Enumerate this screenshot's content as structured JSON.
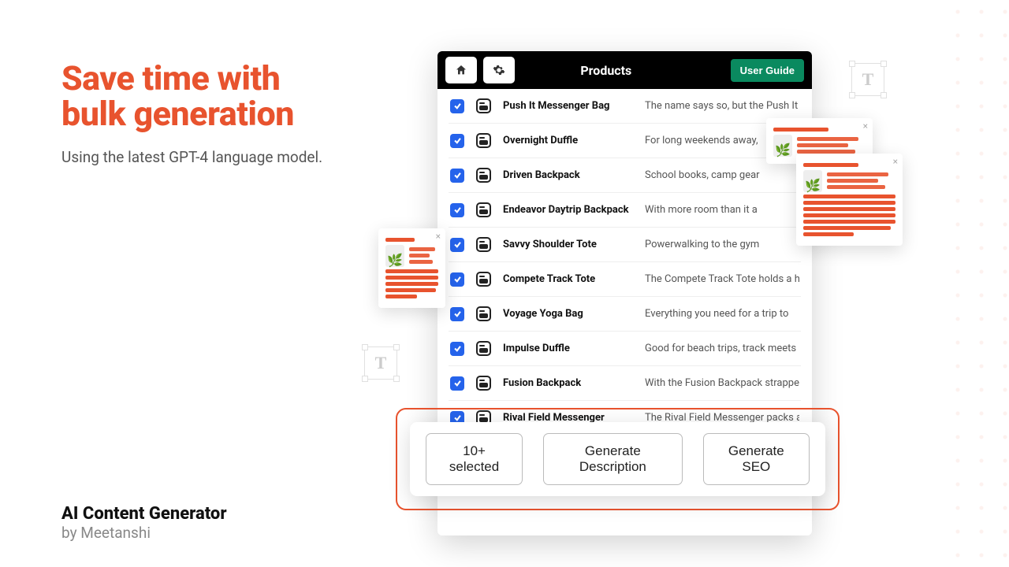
{
  "headline": {
    "title_line1": "Save time with",
    "title_line2": "bulk generation",
    "subtitle": "Using the latest GPT-4 language model."
  },
  "brand": {
    "title": "AI Content Generator",
    "sub": "by Meetanshi"
  },
  "app": {
    "title": "Products",
    "user_guide": "User Guide"
  },
  "products": [
    {
      "name": "Push It Messenger Bag",
      "desc": "The name says so, but the Push It"
    },
    {
      "name": "Overnight Duffle",
      "desc": "For long weekends away,"
    },
    {
      "name": "Driven Backpack",
      "desc": "School books, camp gear"
    },
    {
      "name": "Endeavor Daytrip Backpack",
      "desc": "With more room than it a"
    },
    {
      "name": "Savvy Shoulder Tote",
      "desc": "Powerwalking to the gym"
    },
    {
      "name": "Compete Track Tote",
      "desc": "The Compete Track Tote holds a h"
    },
    {
      "name": "Voyage Yoga Bag",
      "desc": "Everything you need for a trip to"
    },
    {
      "name": "Impulse Duffle",
      "desc": "Good for beach trips, track meets"
    },
    {
      "name": "Fusion Backpack",
      "desc": "With the Fusion Backpack strappe"
    },
    {
      "name": "Rival Field Messenger",
      "desc": "The Rival Field Messenger packs a"
    }
  ],
  "actions": {
    "selected": "10+ selected",
    "gen_desc": "Generate Description",
    "gen_seo": "Generate SEO"
  }
}
